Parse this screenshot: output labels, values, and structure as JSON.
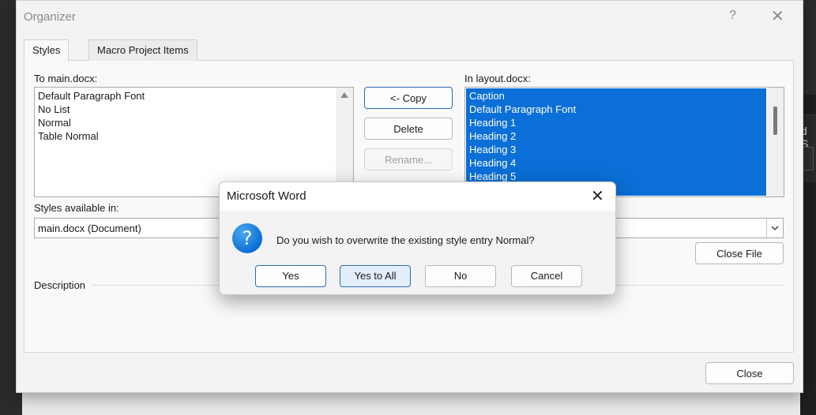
{
  "organizer": {
    "title": "Organizer",
    "help": "?",
    "close": "✕",
    "tabs": [
      {
        "label": "Styles",
        "active": true
      },
      {
        "label": "Macro Project Items",
        "active": false
      }
    ],
    "left": {
      "label": "To main.docx:",
      "items": [
        "Default Paragraph Font",
        "No List",
        "Normal",
        "Table Normal"
      ],
      "available_label": "Styles available in:",
      "available_value": "main.docx (Document)"
    },
    "buttons": {
      "copy": "<- Copy",
      "delete": "Delete",
      "rename": "Rename..."
    },
    "right": {
      "label": "In layout.docx:",
      "items": [
        "Caption",
        "Default Paragraph Font",
        "Heading 1",
        "Heading 2",
        "Heading 3",
        "Heading 4",
        "Heading 5"
      ],
      "close_file": "Close File"
    },
    "description_label": "Description",
    "close_button": "Close"
  },
  "background": {
    "partial_text": "d S"
  },
  "msgbox": {
    "title": "Microsoft Word",
    "close": "✕",
    "icon": "question-icon",
    "icon_glyph": "?",
    "message": "Do you wish to overwrite the existing style entry Normal?",
    "buttons": {
      "yes": "Yes",
      "yes_to_all": "Yes to All",
      "no": "No",
      "cancel": "Cancel"
    }
  },
  "colors": {
    "selection": "#0a6fd6",
    "accent": "#2b6cb0"
  }
}
